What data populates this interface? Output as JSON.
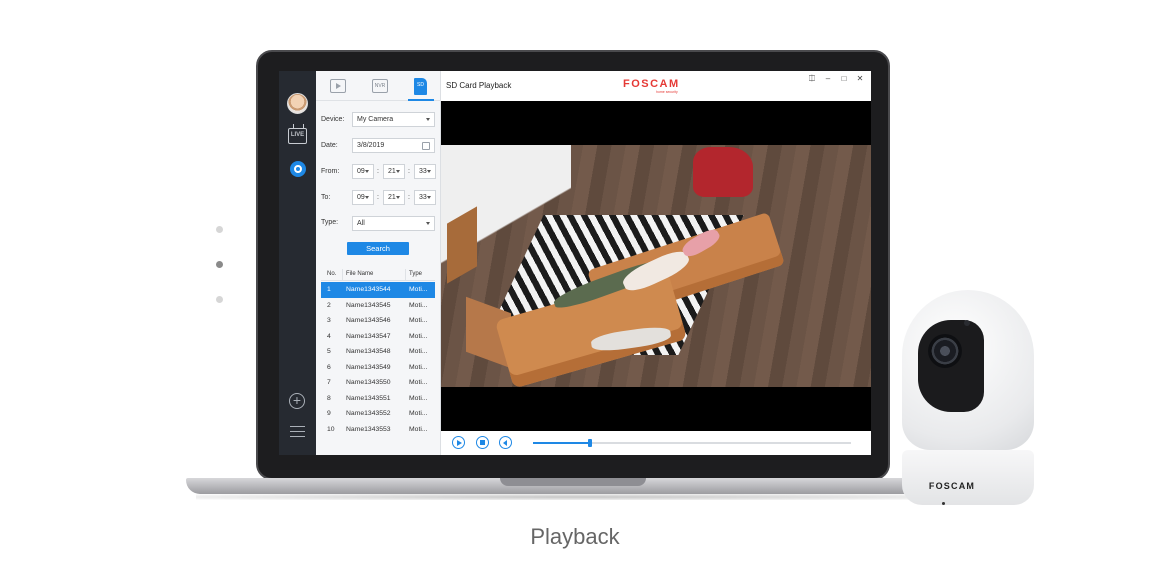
{
  "app": {
    "window_title": "SD Card Playback",
    "logo_text": "FOSCAM",
    "logo_subtitle": "home security"
  },
  "nav": {
    "live_label": "LIVE"
  },
  "tabs": [
    {
      "label": ""
    },
    {
      "label": "NVR"
    },
    {
      "label": "SD"
    }
  ],
  "filters": {
    "device_label": "Device:",
    "device_value": "My Camera",
    "date_label": "Date:",
    "date_value": "3/8/2019",
    "from_label": "From:",
    "from": {
      "h": "09",
      "m": "21",
      "s": "33"
    },
    "to_label": "To:",
    "to": {
      "h": "09",
      "m": "21",
      "s": "33"
    },
    "time_sep": ":",
    "type_label": "Type:",
    "type_value": "All",
    "search_label": "Search"
  },
  "table": {
    "headers": {
      "no": "No.",
      "file": "File Name",
      "type": "Type"
    },
    "rows": [
      {
        "no": "1",
        "file": "Name1343544",
        "type": "Moti..."
      },
      {
        "no": "2",
        "file": "Name1343545",
        "type": "Moti..."
      },
      {
        "no": "3",
        "file": "Name1343546",
        "type": "Moti..."
      },
      {
        "no": "4",
        "file": "Name1343547",
        "type": "Moti..."
      },
      {
        "no": "5",
        "file": "Name1343548",
        "type": "Moti..."
      },
      {
        "no": "6",
        "file": "Name1343549",
        "type": "Moti..."
      },
      {
        "no": "7",
        "file": "Name1343550",
        "type": "Moti..."
      },
      {
        "no": "8",
        "file": "Name1343551",
        "type": "Moti..."
      },
      {
        "no": "9",
        "file": "Name1343552",
        "type": "Moti..."
      },
      {
        "no": "10",
        "file": "Name1343553",
        "type": "Moti..."
      }
    ],
    "selected_row": 1
  },
  "playback": {
    "progress": 0.18
  },
  "camera": {
    "brand": "FOSCAM"
  },
  "caption": "Playback",
  "carousel": {
    "count": 3,
    "active": 2
  },
  "colors": {
    "accent": "#1e88e5",
    "brand": "#e53935",
    "nav_bg": "#262a31"
  }
}
